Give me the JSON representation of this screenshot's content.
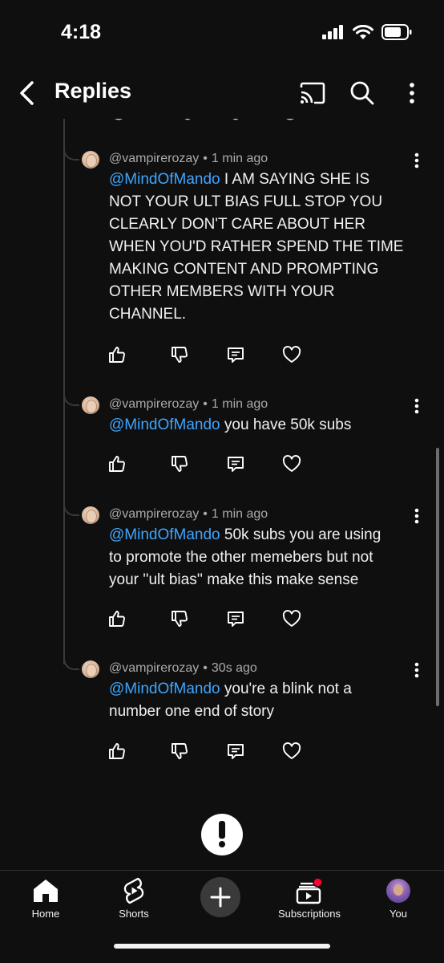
{
  "status_bar": {
    "time": "4:18"
  },
  "header": {
    "title": "Replies"
  },
  "replies": [
    {
      "author": "@vampirerozay",
      "time": "1 min ago",
      "mention": "@MindOfMando",
      "line1_rest": " I AM SAYING SHE IS",
      "lines": [
        "NOT YOUR ULT BIAS FULL STOP YOU",
        "CLEARLY DON'T CARE ABOUT HER",
        "WHEN YOU'D RATHER SPEND THE TIME",
        "MAKING CONTENT AND PROMPTING",
        "OTHER MEMBERS WITH YOUR",
        "CHANNEL."
      ]
    },
    {
      "author": "@vampirerozay",
      "time": "1 min ago",
      "mention": "@MindOfMando",
      "line1_rest": " you have 50k subs",
      "lines": []
    },
    {
      "author": "@vampirerozay",
      "time": "1 min ago",
      "mention": "@MindOfMando",
      "line1_rest": " 50k subs you are using",
      "lines": [
        "to promote the other memebers but not",
        "your ''ult bias'' make this make sense"
      ]
    },
    {
      "author": "@vampirerozay",
      "time": "30s ago",
      "mention": "@MindOfMando",
      "line1_rest": " you're a blink not a",
      "lines": [
        "number one end of story"
      ]
    }
  ],
  "end_notice": {
    "text": ""
  },
  "bottom_nav": {
    "home": "Home",
    "shorts": "Shorts",
    "subscriptions": "Subscriptions",
    "you": "You"
  },
  "colors": {
    "background": "#0f0f0f",
    "mention": "#3ea6ff",
    "meta": "#aaaaaa",
    "notification_dot": "#ff0033"
  },
  "icons": [
    "back-arrow-icon",
    "cast-icon",
    "search-icon",
    "more-vertical-icon",
    "like-icon",
    "dislike-icon",
    "reply-icon",
    "heart-icon",
    "alert-icon",
    "home-icon",
    "shorts-icon",
    "plus-icon",
    "subscriptions-icon"
  ]
}
